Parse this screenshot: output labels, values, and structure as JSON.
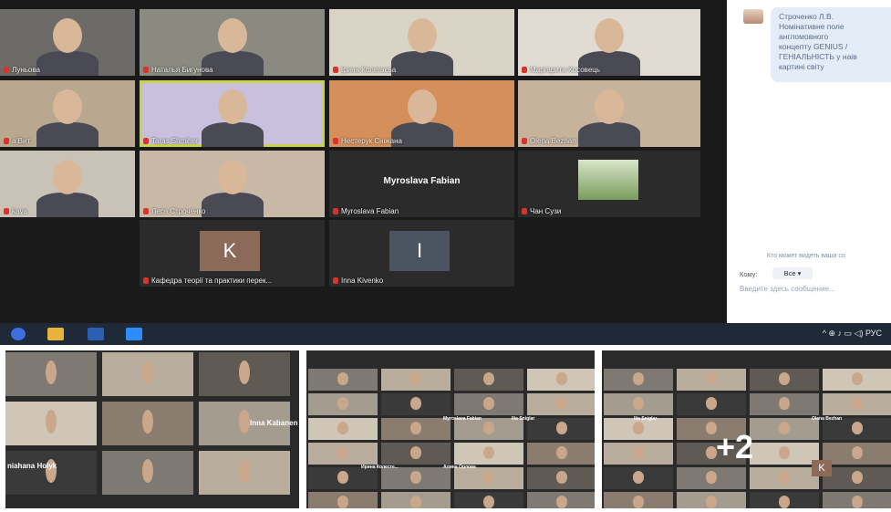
{
  "zoom_main": {
    "tiles": [
      {
        "name": "Луньова",
        "bg": "#6d6b67"
      },
      {
        "name": "Наталья Бигунова",
        "bg": "#8a8a80"
      },
      {
        "name": "Ірина Колегаєва",
        "bg": "#d9d4c5"
      },
      {
        "name": "Маргарита Косовець",
        "bg": "#e0dcd3"
      },
      {
        "name": "а Вит",
        "bg": "#b9a88f"
      },
      {
        "name": "Taras Shmiher",
        "bg": "#c8c0dd"
      },
      {
        "name": "Нестерук Сніжана",
        "bg": "#d48f5a"
      },
      {
        "name": "Olena Bezhan",
        "bg": "#c7b29c"
      },
      {
        "name": "kava",
        "bg": "#c9c3b7"
      },
      {
        "name": "Леся Строченко",
        "bg": "#c8b8a6"
      },
      {
        "name": "Myroslava Fabian",
        "big": "Myroslava Fabian",
        "bg": "#2b2b2b"
      },
      {
        "name": "Чан Сузи",
        "bg": "#2b2b2b"
      },
      {
        "name": "Кафедра теорії та практики перек...",
        "letter": "K",
        "color": "#8c6a5a",
        "bg": "#2b2b2b"
      },
      {
        "name": "Inna Kivenko",
        "letter": "I",
        "color": "#4b5562",
        "bg": "#2b2b2b"
      }
    ]
  },
  "chat": {
    "message": "Строченко Л.В.\nНомінативне поле\nангломовного\nконцепту GENIUS /\nГЕНІАЛЬНІСТЬ у наів\nкартині світу",
    "who_can_see": "Кто может видеть ваши со",
    "to_label": "Кому:",
    "to_value": "Все",
    "input_placeholder": "Введите здесь сообщение..."
  },
  "taskbar": {
    "tray_text": "^ ⊕ ♪ ▭ ◁) РУС"
  },
  "shots": {
    "left_names": [
      "Inna Kabanen",
      "niahana Holyk"
    ],
    "middle_names": [
      "Myroslava Fabian",
      "Ilia Sniglar",
      "Ирина Колесте...",
      "Алина Орлова"
    ],
    "right_names": [
      "Ilia Sniglar",
      "Olena Bezhan"
    ],
    "right_overlay": "+2",
    "right_letter": "K"
  }
}
